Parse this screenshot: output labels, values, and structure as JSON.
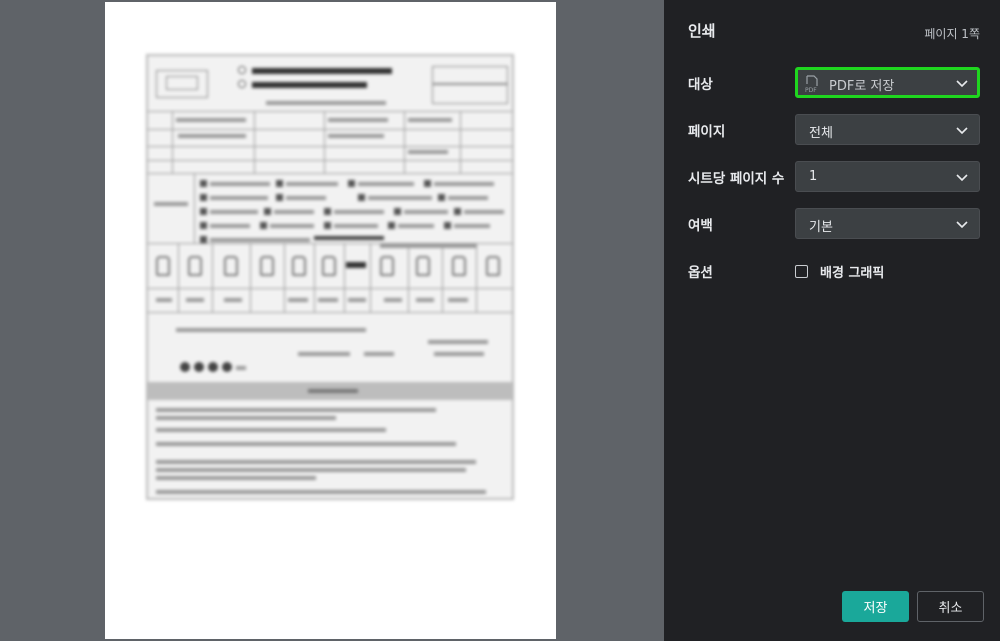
{
  "sidebar": {
    "title": "인쇄",
    "page_count": "페이지 1쪽",
    "destination": {
      "label": "대상",
      "value": "PDF로 저장"
    },
    "pages": {
      "label": "페이지",
      "value": "전체"
    },
    "pages_per_sheet": {
      "label": "시트당 페이지 수",
      "value": "1"
    },
    "margins": {
      "label": "여백",
      "value": "기본"
    },
    "options": {
      "label": "옵션",
      "background_graphics": "배경 그래픽",
      "background_graphics_checked": false
    },
    "save_label": "저장",
    "cancel_label": "취소"
  },
  "colors": {
    "sidebar_bg": "#202124",
    "preview_bg": "#5f6368",
    "accent": "#1aa89a",
    "focus_ring": "#1fd61f"
  }
}
